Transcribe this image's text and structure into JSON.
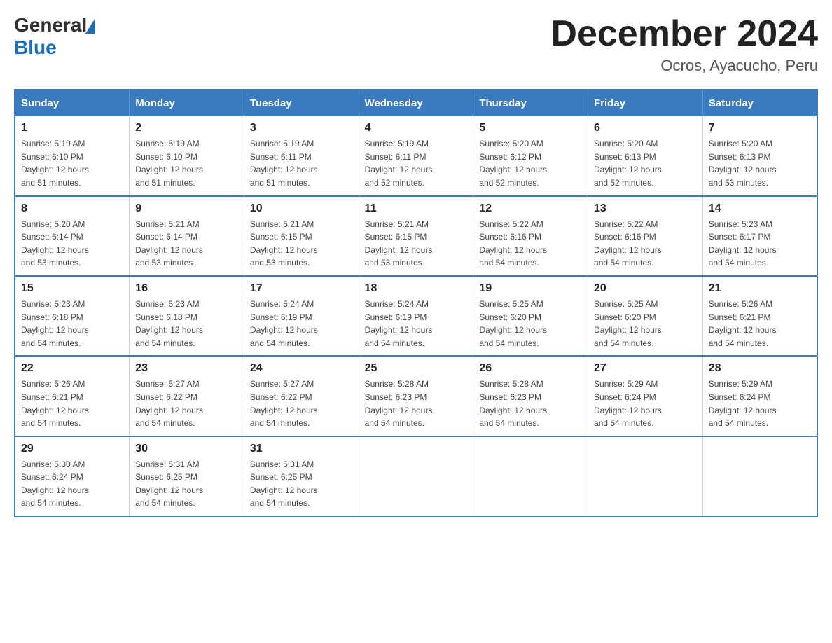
{
  "header": {
    "logo": {
      "general": "General",
      "blue": "Blue"
    },
    "month_year": "December 2024",
    "location": "Ocros, Ayacucho, Peru"
  },
  "days_of_week": [
    "Sunday",
    "Monday",
    "Tuesday",
    "Wednesday",
    "Thursday",
    "Friday",
    "Saturday"
  ],
  "weeks": [
    [
      {
        "day": "1",
        "sunrise": "5:19 AM",
        "sunset": "6:10 PM",
        "daylight": "12 hours and 51 minutes."
      },
      {
        "day": "2",
        "sunrise": "5:19 AM",
        "sunset": "6:10 PM",
        "daylight": "12 hours and 51 minutes."
      },
      {
        "day": "3",
        "sunrise": "5:19 AM",
        "sunset": "6:11 PM",
        "daylight": "12 hours and 51 minutes."
      },
      {
        "day": "4",
        "sunrise": "5:19 AM",
        "sunset": "6:11 PM",
        "daylight": "12 hours and 52 minutes."
      },
      {
        "day": "5",
        "sunrise": "5:20 AM",
        "sunset": "6:12 PM",
        "daylight": "12 hours and 52 minutes."
      },
      {
        "day": "6",
        "sunrise": "5:20 AM",
        "sunset": "6:13 PM",
        "daylight": "12 hours and 52 minutes."
      },
      {
        "day": "7",
        "sunrise": "5:20 AM",
        "sunset": "6:13 PM",
        "daylight": "12 hours and 53 minutes."
      }
    ],
    [
      {
        "day": "8",
        "sunrise": "5:20 AM",
        "sunset": "6:14 PM",
        "daylight": "12 hours and 53 minutes."
      },
      {
        "day": "9",
        "sunrise": "5:21 AM",
        "sunset": "6:14 PM",
        "daylight": "12 hours and 53 minutes."
      },
      {
        "day": "10",
        "sunrise": "5:21 AM",
        "sunset": "6:15 PM",
        "daylight": "12 hours and 53 minutes."
      },
      {
        "day": "11",
        "sunrise": "5:21 AM",
        "sunset": "6:15 PM",
        "daylight": "12 hours and 53 minutes."
      },
      {
        "day": "12",
        "sunrise": "5:22 AM",
        "sunset": "6:16 PM",
        "daylight": "12 hours and 54 minutes."
      },
      {
        "day": "13",
        "sunrise": "5:22 AM",
        "sunset": "6:16 PM",
        "daylight": "12 hours and 54 minutes."
      },
      {
        "day": "14",
        "sunrise": "5:23 AM",
        "sunset": "6:17 PM",
        "daylight": "12 hours and 54 minutes."
      }
    ],
    [
      {
        "day": "15",
        "sunrise": "5:23 AM",
        "sunset": "6:18 PM",
        "daylight": "12 hours and 54 minutes."
      },
      {
        "day": "16",
        "sunrise": "5:23 AM",
        "sunset": "6:18 PM",
        "daylight": "12 hours and 54 minutes."
      },
      {
        "day": "17",
        "sunrise": "5:24 AM",
        "sunset": "6:19 PM",
        "daylight": "12 hours and 54 minutes."
      },
      {
        "day": "18",
        "sunrise": "5:24 AM",
        "sunset": "6:19 PM",
        "daylight": "12 hours and 54 minutes."
      },
      {
        "day": "19",
        "sunrise": "5:25 AM",
        "sunset": "6:20 PM",
        "daylight": "12 hours and 54 minutes."
      },
      {
        "day": "20",
        "sunrise": "5:25 AM",
        "sunset": "6:20 PM",
        "daylight": "12 hours and 54 minutes."
      },
      {
        "day": "21",
        "sunrise": "5:26 AM",
        "sunset": "6:21 PM",
        "daylight": "12 hours and 54 minutes."
      }
    ],
    [
      {
        "day": "22",
        "sunrise": "5:26 AM",
        "sunset": "6:21 PM",
        "daylight": "12 hours and 54 minutes."
      },
      {
        "day": "23",
        "sunrise": "5:27 AM",
        "sunset": "6:22 PM",
        "daylight": "12 hours and 54 minutes."
      },
      {
        "day": "24",
        "sunrise": "5:27 AM",
        "sunset": "6:22 PM",
        "daylight": "12 hours and 54 minutes."
      },
      {
        "day": "25",
        "sunrise": "5:28 AM",
        "sunset": "6:23 PM",
        "daylight": "12 hours and 54 minutes."
      },
      {
        "day": "26",
        "sunrise": "5:28 AM",
        "sunset": "6:23 PM",
        "daylight": "12 hours and 54 minutes."
      },
      {
        "day": "27",
        "sunrise": "5:29 AM",
        "sunset": "6:24 PM",
        "daylight": "12 hours and 54 minutes."
      },
      {
        "day": "28",
        "sunrise": "5:29 AM",
        "sunset": "6:24 PM",
        "daylight": "12 hours and 54 minutes."
      }
    ],
    [
      {
        "day": "29",
        "sunrise": "5:30 AM",
        "sunset": "6:24 PM",
        "daylight": "12 hours and 54 minutes."
      },
      {
        "day": "30",
        "sunrise": "5:31 AM",
        "sunset": "6:25 PM",
        "daylight": "12 hours and 54 minutes."
      },
      {
        "day": "31",
        "sunrise": "5:31 AM",
        "sunset": "6:25 PM",
        "daylight": "12 hours and 54 minutes."
      },
      null,
      null,
      null,
      null
    ]
  ],
  "labels": {
    "sunrise": "Sunrise:",
    "sunset": "Sunset:",
    "daylight": "Daylight:"
  }
}
